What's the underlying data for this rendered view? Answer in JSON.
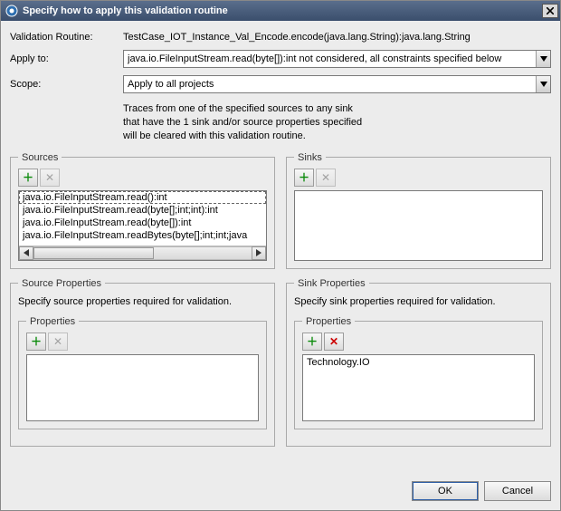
{
  "title": "Specify how to apply this validation routine",
  "labels": {
    "validation_routine": "Validation Routine:",
    "apply_to": "Apply to:",
    "scope": "Scope:"
  },
  "values": {
    "validation_routine": "TestCase_IOT_Instance_Val_Encode.encode(java.lang.String):java.lang.String",
    "apply_to": "java.io.FileInputStream.read(byte[]):int not considered, all constraints specified below",
    "scope": "Apply to all projects"
  },
  "description_lines": {
    "l1": "Traces from one of the specified sources to any sink",
    "l2": "that have the 1 sink and/or source properties specified",
    "l3": "will be cleared with this validation routine."
  },
  "groups": {
    "sources": "Sources",
    "sinks": "Sinks",
    "source_properties": "Source Properties",
    "sink_properties": "Sink Properties",
    "properties": "Properties"
  },
  "instructions": {
    "source_props": "Specify source properties required for validation.",
    "sink_props": "Specify sink properties required for validation."
  },
  "sources_items": {
    "i0": "java.io.FileInputStream.read():int",
    "i1": "java.io.FileInputStream.read(byte[];int;int):int",
    "i2": "java.io.FileInputStream.read(byte[]):int",
    "i3": "java.io.FileInputStream.readBytes(byte[];int;int;java"
  },
  "sink_props_items": {
    "i0": "Technology.IO"
  },
  "icons": {
    "add": "＋",
    "remove": "✕"
  },
  "buttons": {
    "ok": "OK",
    "cancel": "Cancel"
  }
}
